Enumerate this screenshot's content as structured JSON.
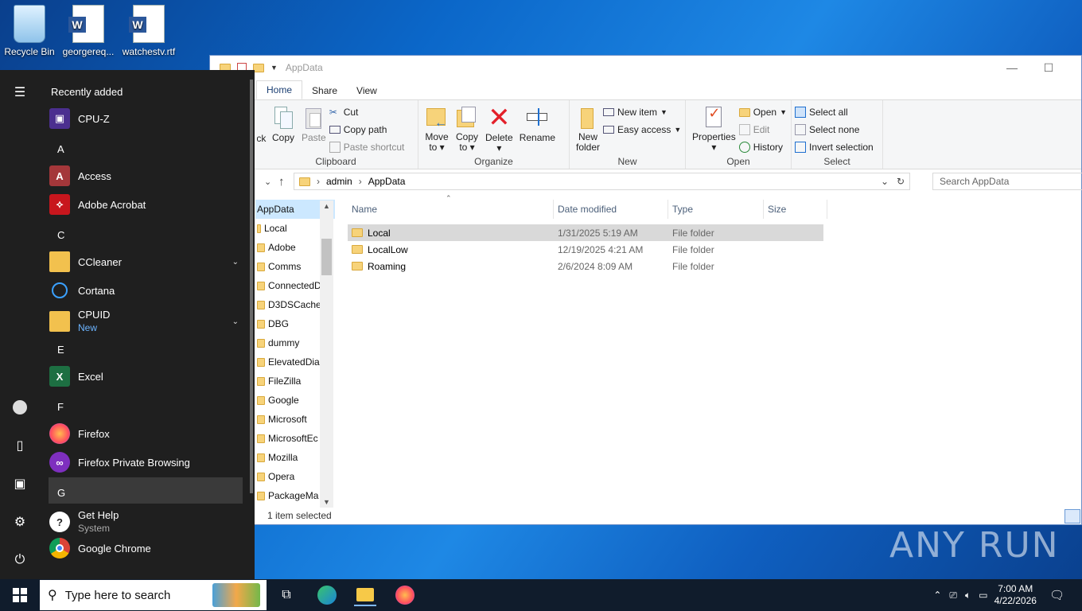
{
  "desktop": {
    "icons": [
      {
        "label": "Recycle Bin"
      },
      {
        "label": "georgereq..."
      },
      {
        "label": "watchestv.rtf"
      }
    ]
  },
  "explorer": {
    "title": "AppData",
    "tabs": [
      "Home",
      "Share",
      "View"
    ],
    "ribbon": {
      "clipboard": {
        "label": "Clipboard",
        "pin_partial": "ick",
        "copy": "Copy",
        "paste": "Paste",
        "cut": "Cut",
        "copy_path": "Copy path",
        "paste_shortcut": "Paste shortcut"
      },
      "organize": {
        "label": "Organize",
        "move_to": "Move",
        "move_to2": "to",
        "copy_to": "Copy",
        "copy_to2": "to",
        "delete": "Delete",
        "rename": "Rename"
      },
      "new": {
        "label": "New",
        "new_folder": "New",
        "new_folder2": "folder",
        "new_item": "New item",
        "easy_access": "Easy access"
      },
      "open": {
        "label": "Open",
        "properties": "Properties",
        "open": "Open",
        "edit": "Edit",
        "history": "History"
      },
      "select": {
        "label": "Select",
        "select_all": "Select all",
        "select_none": "Select none",
        "invert": "Invert selection"
      }
    },
    "address": {
      "crumbs": [
        "admin",
        "AppData"
      ]
    },
    "search": {
      "placeholder": "Search AppData"
    },
    "nav": [
      "AppData",
      "Local",
      "Adobe",
      "Comms",
      "ConnectedD",
      "D3DSCache",
      "DBG",
      "dummy",
      "ElevatedDia",
      "FileZilla",
      "Google",
      "Microsoft",
      "MicrosoftEc",
      "Mozilla",
      "Opera",
      "PackageMa"
    ],
    "columns": [
      "Name",
      "Date modified",
      "Type",
      "Size"
    ],
    "files": [
      {
        "name": "Local",
        "date": "1/31/2025 5:19 AM",
        "type": "File folder",
        "size": ""
      },
      {
        "name": "LocalLow",
        "date": "12/19/2025 4:21 AM",
        "type": "File folder",
        "size": ""
      },
      {
        "name": "Roaming",
        "date": "2/6/2024 8:09 AM",
        "type": "File folder",
        "size": ""
      }
    ],
    "status": "1 item selected"
  },
  "start_menu": {
    "header": "Recently added",
    "items": [
      {
        "kind": "app",
        "label": "CPU-Z"
      },
      {
        "kind": "letter",
        "label": "A"
      },
      {
        "kind": "app",
        "label": "Access"
      },
      {
        "kind": "app",
        "label": "Adobe Acrobat"
      },
      {
        "kind": "letter",
        "label": "C"
      },
      {
        "kind": "app",
        "label": "CCleaner"
      },
      {
        "kind": "app",
        "label": "Cortana"
      },
      {
        "kind": "app",
        "label": "CPUID",
        "sub": "New"
      },
      {
        "kind": "letter",
        "label": "E"
      },
      {
        "kind": "app",
        "label": "Excel"
      },
      {
        "kind": "letter",
        "label": "F"
      },
      {
        "kind": "app",
        "label": "Firefox"
      },
      {
        "kind": "app",
        "label": "Firefox Private Browsing"
      },
      {
        "kind": "letter",
        "label": "G"
      },
      {
        "kind": "app",
        "label": "Get Help",
        "sub": "System"
      },
      {
        "kind": "app",
        "label": "Google Chrome"
      }
    ]
  },
  "taskbar": {
    "search_placeholder": "Type here to search",
    "time": "7:00 AM",
    "date": "4/22/2026"
  },
  "watermark": "ANY RUN"
}
